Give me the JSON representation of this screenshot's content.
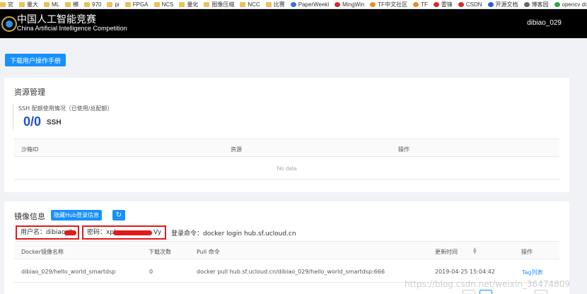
{
  "bookmarks": [
    {
      "label": "官",
      "kind": "folder"
    },
    {
      "label": "量大",
      "kind": "folder"
    },
    {
      "label": "ML",
      "kind": "folder"
    },
    {
      "label": "模",
      "kind": "folder"
    },
    {
      "label": "970",
      "kind": "folder"
    },
    {
      "label": "pi",
      "kind": "folder"
    },
    {
      "label": "FPGA",
      "kind": "folder"
    },
    {
      "label": "NCS",
      "kind": "folder"
    },
    {
      "label": "量化",
      "kind": "folder"
    },
    {
      "label": "图像压缩",
      "kind": "folder"
    },
    {
      "label": "NCC",
      "kind": "folder"
    },
    {
      "label": "比赛",
      "kind": "folder"
    },
    {
      "label": "PaperWeekl",
      "kind": "site",
      "color": "#3b6fd6"
    },
    {
      "label": "MingWin",
      "kind": "site",
      "color": "#d62b2b"
    },
    {
      "label": "TF中文社区",
      "kind": "site",
      "color": "#f08a24"
    },
    {
      "label": "TF",
      "kind": "site",
      "color": "#f08a24"
    },
    {
      "label": "雷锋",
      "kind": "site",
      "color": "#d62b2b"
    },
    {
      "label": "CSDN",
      "kind": "site",
      "color": "#d62b2b"
    },
    {
      "label": "开源文档",
      "kind": "site",
      "color": "#2b5fd6"
    },
    {
      "label": "博客园",
      "kind": "site",
      "color": "#666666"
    },
    {
      "label": "opencv do",
      "kind": "site",
      "color": "#2ba84a"
    }
  ],
  "header": {
    "title_cn": "中国人工智能竞赛",
    "title_en": "China Artificial Intelligence Competition",
    "username": "dibiao_029"
  },
  "manual_button": "下载用户操作手册",
  "resources": {
    "title": "资源管理",
    "quota_label": "SSH 配额使用情况（已使用/总配额）",
    "quota_value": "0/0",
    "quota_unit": "SSH",
    "columns": [
      "沙箱ID",
      "资源",
      "操作"
    ],
    "empty_text": "No data"
  },
  "images": {
    "title": "镜像信息",
    "hide_button": "隐藏Hub登录信息",
    "refresh_icon": "↻",
    "username_text": "用户名：dibiao_0",
    "password_text": "密码：xpl",
    "password_tail": "Vy",
    "login_command": "登录命令：docker login hub.sf.ucloud.cn",
    "columns": [
      "Docker镜像名称",
      "下载次数",
      "Pull 命令",
      "更新时间",
      "操作"
    ],
    "rows": [
      {
        "name": "dibiao_029/hello_world_smartdsp",
        "downloads": "0",
        "pull": "docker pull hub.sf.ucloud.cn/dibiao_029/hello_world_smartdsp:666",
        "updated": "2019-04-25 15:04:42",
        "action": "Tag列表"
      }
    ]
  },
  "watermark": "https://blog.csdn.net/weixin_36474809",
  "colors": {
    "accent": "#1890ff",
    "header_bg": "#000000",
    "quota": "#1f4fd9",
    "annotation": "#e21a1a"
  }
}
